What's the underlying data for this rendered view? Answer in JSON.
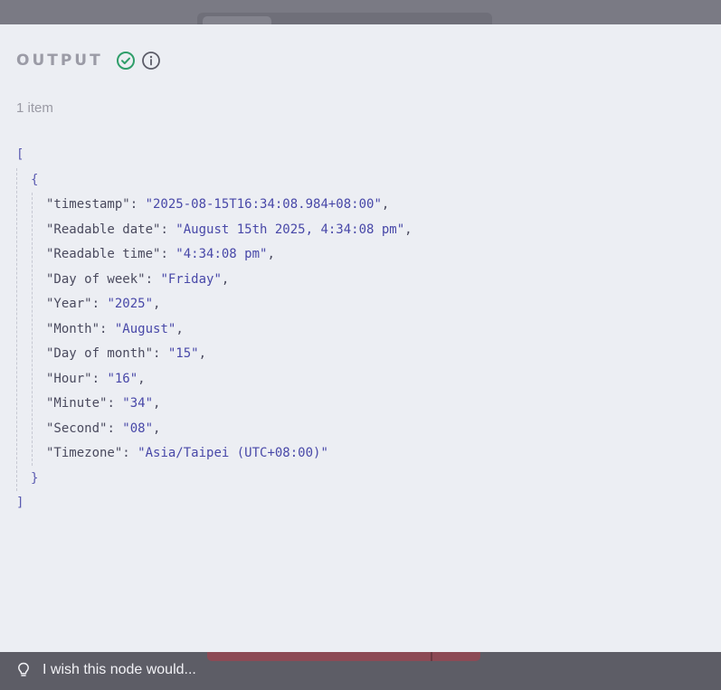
{
  "panel": {
    "title": "OUTPUT",
    "status_icon": "check-circle-icon",
    "info_icon": "info-circle-icon",
    "item_count": "1 item",
    "colors": {
      "success": "#2f9e6a",
      "info": "#5c5c68",
      "string": "#4848a8",
      "bracket": "#5a5ab0"
    }
  },
  "json": {
    "open_array": "[",
    "open_object": "{",
    "entries": [
      {
        "key": "\"timestamp\"",
        "value": "\"2025-08-15T16:34:08.984+08:00\""
      },
      {
        "key": "\"Readable date\"",
        "value": "\"August 15th 2025, 4:34:08 pm\""
      },
      {
        "key": "\"Readable time\"",
        "value": "\"4:34:08 pm\""
      },
      {
        "key": "\"Day of week\"",
        "value": "\"Friday\""
      },
      {
        "key": "\"Year\"",
        "value": "\"2025\""
      },
      {
        "key": "\"Month\"",
        "value": "\"August\""
      },
      {
        "key": "\"Day of month\"",
        "value": "\"15\""
      },
      {
        "key": "\"Hour\"",
        "value": "\"16\""
      },
      {
        "key": "\"Minute\"",
        "value": "\"34\""
      },
      {
        "key": "\"Second\"",
        "value": "\"08\""
      },
      {
        "key": "\"Timezone\"",
        "value": "\"Asia/Taipei (UTC+08:00)\""
      }
    ],
    "close_object": "}",
    "close_array": "]"
  },
  "footer": {
    "feedback_icon": "lightbulb-icon",
    "feedback_text": "I wish this node would..."
  }
}
